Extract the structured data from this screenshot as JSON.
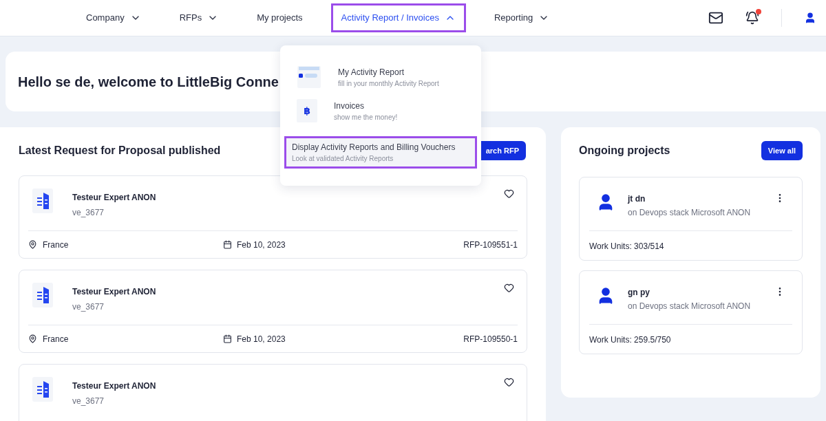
{
  "nav": {
    "items": [
      {
        "label": "Company",
        "selected": false,
        "expanded": false
      },
      {
        "label": "RFPs",
        "selected": false,
        "expanded": false
      },
      {
        "label": "My projects",
        "selected": false
      },
      {
        "label": "Activity Report / Invoices",
        "selected": true,
        "expanded": true
      },
      {
        "label": "Reporting",
        "selected": false,
        "expanded": false
      }
    ],
    "notifications_unread": true
  },
  "menu": {
    "items": [
      {
        "kind": "report",
        "title": "My Activity Report",
        "subtitle": "fill in your monthly Activity Report",
        "selected": false
      },
      {
        "kind": "invoice",
        "icon": "฿",
        "title": "Invoices",
        "subtitle": "show me the money!",
        "selected": false
      },
      {
        "kind": "plain",
        "title": "Display Activity Reports and Billing Vouchers",
        "subtitle": "Look at validated Activity Reports",
        "selected": true
      }
    ]
  },
  "welcome": {
    "title": "Hello se de, welcome to LittleBig Conne"
  },
  "rfps": {
    "title": "Latest Request for Proposal published",
    "button": "arch RFP",
    "cards": [
      {
        "title": "Testeur Expert ANON",
        "subtitle": "ve_3677",
        "location": "France",
        "date": "Feb 10, 2023",
        "reference": "RFP-109551-1"
      },
      {
        "title": "Testeur Expert ANON",
        "subtitle": "ve_3677",
        "location": "France",
        "date": "Feb 10, 2023",
        "reference": "RFP-109550-1"
      },
      {
        "title": "Testeur Expert ANON",
        "subtitle": "ve_3677"
      }
    ]
  },
  "projects": {
    "title": "Ongoing projects",
    "button": "View all",
    "cards": [
      {
        "name": "jt dn",
        "subtitle": "on Devops stack Microsoft ANON",
        "work_units": "Work Units: 303/514"
      },
      {
        "name": "gn py",
        "subtitle": "on Devops stack Microsoft ANON",
        "work_units": "Work Units: 259.5/750"
      }
    ]
  }
}
